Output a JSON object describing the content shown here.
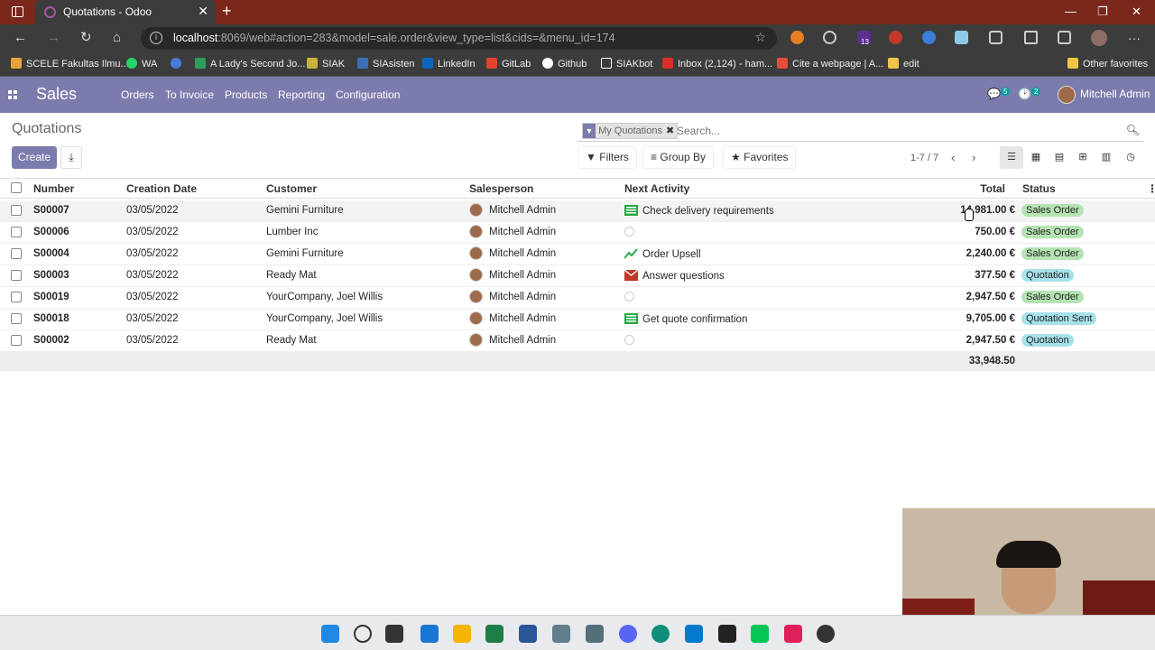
{
  "browser": {
    "tab_title": "Quotations - Odoo",
    "url_host": "localhost",
    "url_rest": ":8069/web#action=283&model=sale.order&view_type=list&cids=&menu_id=174",
    "extension_badge": "13",
    "bookmarks": [
      {
        "label": "SCELE Fakultas Ilmu...",
        "color": "#e8a33d"
      },
      {
        "label": "WA",
        "color": "#25d366"
      },
      {
        "label": "",
        "color": "#4a7bd8"
      },
      {
        "label": "A Lady's Second Jo...",
        "color": "#2e9d5b"
      },
      {
        "label": "SIAK",
        "color": "#c9b33a"
      },
      {
        "label": "SIAsisten",
        "color": "#3b6fb6"
      },
      {
        "label": "LinkedIn",
        "color": "#0a66c2"
      },
      {
        "label": "GitLab",
        "color": "#e2432a"
      },
      {
        "label": "Github",
        "color": "#ffffff"
      },
      {
        "label": "SIAKbot",
        "color": "#ffffff"
      },
      {
        "label": "Inbox (2,124) - ham...",
        "color": "#d93025"
      },
      {
        "label": "Cite a webpage | A...",
        "color": "#e44d3a"
      },
      {
        "label": "edit",
        "color": "#f0c548"
      }
    ],
    "other_favorites": "Other favorites"
  },
  "app": {
    "brand": "Sales",
    "menu": [
      "Orders",
      "To Invoice",
      "Products",
      "Reporting",
      "Configuration"
    ],
    "messages_count": "5",
    "activities_count": "2",
    "user": "Mitchell Admin"
  },
  "control_panel": {
    "title": "Quotations",
    "create_label": "Create",
    "facet_label": "My Quotations",
    "search_placeholder": "Search...",
    "filters_label": "Filters",
    "groupby_label": "Group By",
    "favorites_label": "Favorites",
    "pager": "1-7 / 7"
  },
  "table": {
    "headers": {
      "number": "Number",
      "date": "Creation Date",
      "customer": "Customer",
      "salesperson": "Salesperson",
      "activity": "Next Activity",
      "total": "Total",
      "status": "Status"
    },
    "rows": [
      {
        "number": "S00007",
        "date": "03/05/2022",
        "customer": "Gemini Furniture",
        "salesperson": "Mitchell Admin",
        "activity": "Check delivery requirements",
        "activity_icon": "list-icon",
        "total": "14,981.00 €",
        "status": "Sales Order"
      },
      {
        "number": "S00006",
        "date": "03/05/2022",
        "customer": "Lumber Inc",
        "salesperson": "Mitchell Admin",
        "activity": "",
        "activity_icon": "clock-icon",
        "total": "750.00 €",
        "status": "Sales Order"
      },
      {
        "number": "S00004",
        "date": "03/05/2022",
        "customer": "Gemini Furniture",
        "salesperson": "Mitchell Admin",
        "activity": "Order Upsell",
        "activity_icon": "chart-icon",
        "total": "2,240.00 €",
        "status": "Sales Order"
      },
      {
        "number": "S00003",
        "date": "03/05/2022",
        "customer": "Ready Mat",
        "salesperson": "Mitchell Admin",
        "activity": "Answer questions",
        "activity_icon": "email-icon",
        "total": "377.50 €",
        "status": "Quotation"
      },
      {
        "number": "S00019",
        "date": "03/05/2022",
        "customer": "YourCompany, Joel Willis",
        "salesperson": "Mitchell Admin",
        "activity": "",
        "activity_icon": "clock-icon",
        "total": "2,947.50 €",
        "status": "Sales Order"
      },
      {
        "number": "S00018",
        "date": "03/05/2022",
        "customer": "YourCompany, Joel Willis",
        "salesperson": "Mitchell Admin",
        "activity": "Get quote confirmation",
        "activity_icon": "list-icon",
        "total": "9,705.00 €",
        "status": "Quotation Sent"
      },
      {
        "number": "S00002",
        "date": "03/05/2022",
        "customer": "Ready Mat",
        "salesperson": "Mitchell Admin",
        "activity": "",
        "activity_icon": "clock-icon",
        "total": "2,947.50 €",
        "status": "Quotation"
      }
    ],
    "sum_total": "33,948.50"
  },
  "colors": {
    "navbar": "#7c7bad",
    "status_sales_order": "#b5e3b3",
    "status_quotation": "#a7e1ea",
    "status_quotation_sent": "#a7e1ea",
    "activity_green": "#28a745",
    "activity_red": "#c0392b"
  }
}
